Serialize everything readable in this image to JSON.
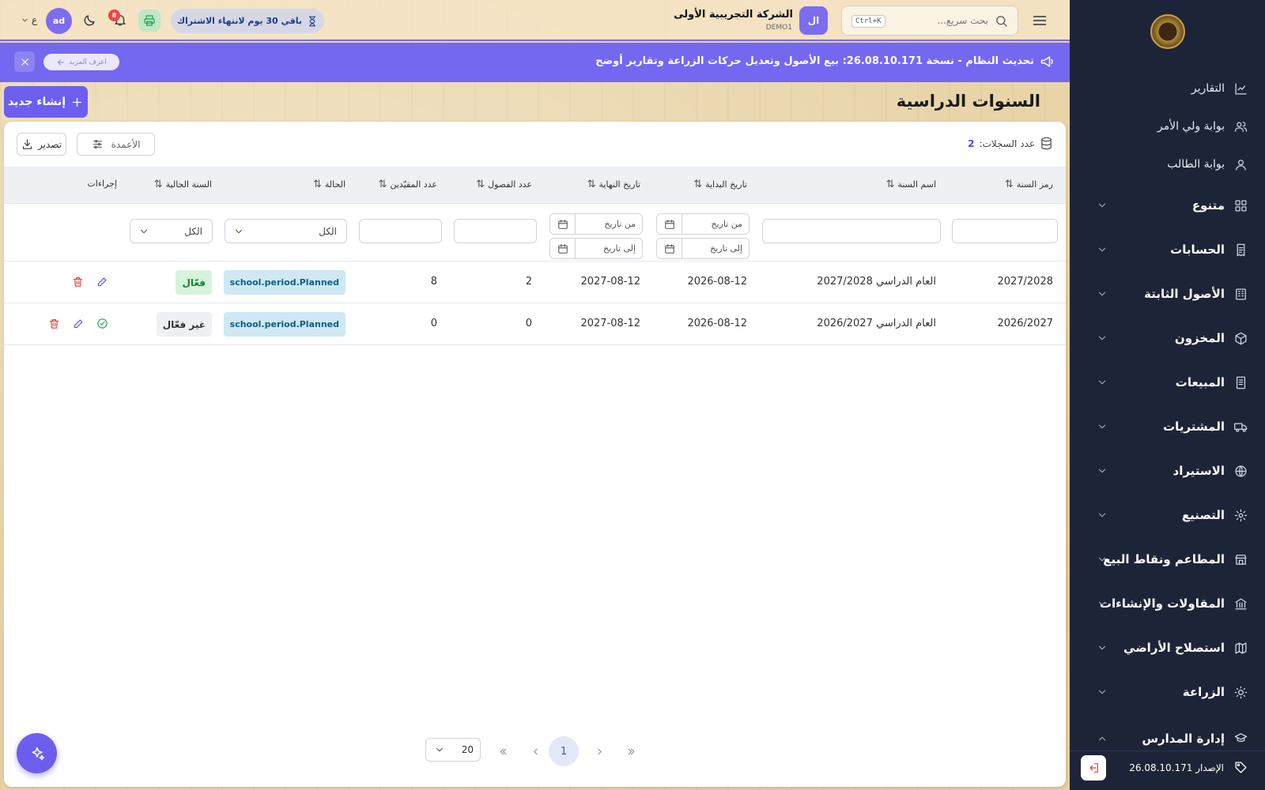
{
  "header": {
    "search_placeholder": "بحث سريع...",
    "search_shortcut": "Ctrl+K",
    "company_initials": "ال",
    "company_name": "الشركة التجريبية الأولى",
    "company_code": "DEMO1",
    "subscription_badge": "باقي 30 يوم لانتهاء الاشتراك",
    "notification_count": "8",
    "user_initials": "ad",
    "language": "ع"
  },
  "announcement": {
    "text": "تحديث النظام - نسخة 26.08.10.171: بيع الأصول وتعديل حركات الزراعة وتقارير أوضح",
    "learn_more": "اعرف المزيد"
  },
  "page": {
    "title": "السنوات الدراسية",
    "create_label": "إنشاء جديد",
    "records_label": "عدد السجلات:",
    "records_count": "2",
    "columns_label": "الأعمدة",
    "export_label": "تصدير"
  },
  "table": {
    "columns": [
      "رمز السنة",
      "اسم السنة",
      "تاريخ البداية",
      "تاريخ النهاية",
      "عدد الفصول",
      "عدد المقيّدين",
      "الحالة",
      "السنة الحالية",
      "إجراءات"
    ],
    "filters": {
      "from_date": "من تاريخ",
      "to_date": "إلى تاريخ",
      "status_all": "الكل",
      "current_all": "الكل"
    },
    "rows": [
      {
        "code": "2027/2028",
        "name": "العام الدراسي 2027/2028",
        "start": "2026-08-12",
        "end": "2027-08-12",
        "classes": "2",
        "enrolled": "8",
        "status": "school.period.Planned",
        "current": "فعّال"
      },
      {
        "code": "2026/2027",
        "name": "العام الدراسي 2026/2027",
        "start": "2026-08-12",
        "end": "2027-08-12",
        "classes": "0",
        "enrolled": "0",
        "status": "school.period.Planned",
        "current": "غير فعّال"
      }
    ]
  },
  "pagination": {
    "current_page": "1",
    "page_size": "20"
  },
  "sidebar": {
    "items": [
      {
        "label": "التقارير",
        "icon": "chart-line-icon"
      },
      {
        "label": "بوابة ولي الأمر",
        "icon": "users-icon"
      },
      {
        "label": "بوابة الطالب",
        "icon": "user-icon"
      }
    ],
    "groups": [
      {
        "label": "متنوع",
        "icon": "grid-icon"
      },
      {
        "label": "الحسابات",
        "icon": "receipt-icon"
      },
      {
        "label": "الأصول الثابتة",
        "icon": "building-icon"
      },
      {
        "label": "المخزون",
        "icon": "box-icon"
      },
      {
        "label": "المبيعات",
        "icon": "invoice-icon"
      },
      {
        "label": "المشتريات",
        "icon": "truck-icon"
      },
      {
        "label": "الاستيراد",
        "icon": "globe-icon"
      },
      {
        "label": "التصنيع",
        "icon": "gear-icon"
      },
      {
        "label": "المطاعم ونقاط البيع",
        "icon": "store-icon"
      },
      {
        "label": "المقاولات والإنشاءات",
        "icon": "bank-icon"
      },
      {
        "label": "استصلاح الأراضي",
        "icon": "map-icon"
      },
      {
        "label": "الزراعة",
        "icon": "sun-icon"
      },
      {
        "label": "إدارة المدارس",
        "icon": "graduation-cap-icon"
      }
    ],
    "version_label": "الإصدار 26.08.10.171"
  },
  "colors": {
    "accent": "#6d5ef0",
    "sidebar_bg": "#1e2437",
    "announcement_bg": "#7468f0",
    "active_green": "#15803d",
    "period_badge": "#cfe8f3"
  }
}
